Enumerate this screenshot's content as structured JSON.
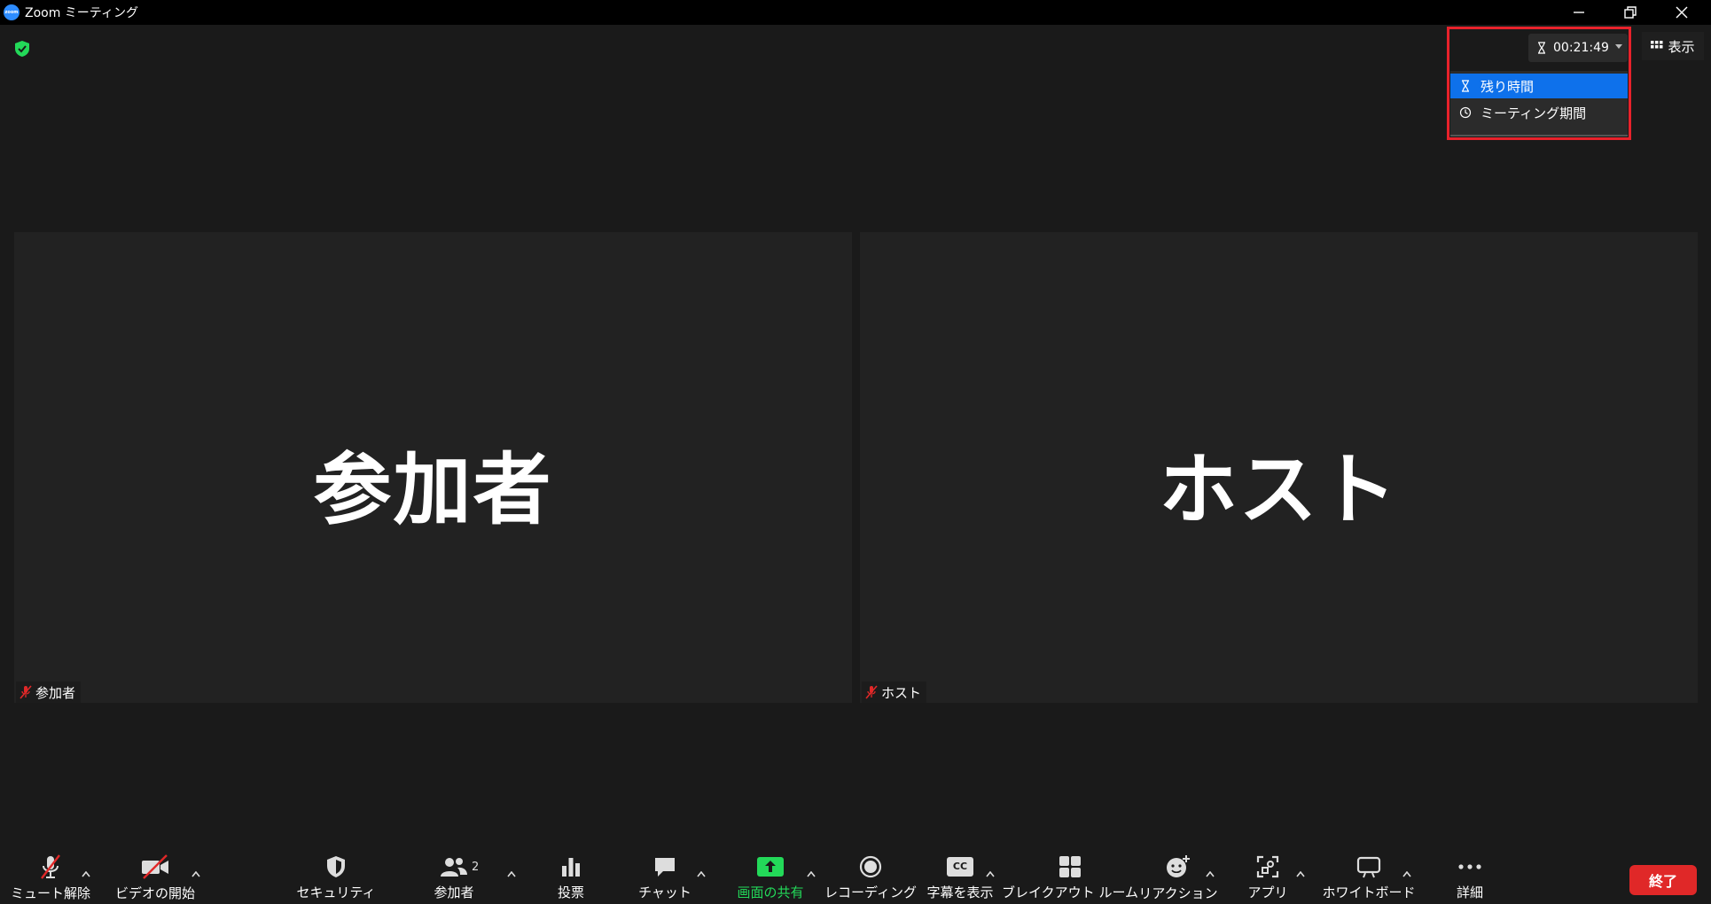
{
  "window": {
    "title": "Zoom ミーティング",
    "logo_text": "zoom"
  },
  "timer": {
    "value": "00:21:49",
    "menu": [
      {
        "label": "残り時間",
        "icon": "hourglass-icon",
        "selected": true
      },
      {
        "label": "ミーティング期間",
        "icon": "clock-icon",
        "selected": false
      }
    ],
    "highlight_color": "#e8222b"
  },
  "view_button": {
    "label": "表示"
  },
  "tiles": [
    {
      "name": "参加者",
      "label": "参加者",
      "muted": true
    },
    {
      "name": "ホスト",
      "label": "ホスト",
      "muted": true
    }
  ],
  "toolbar": {
    "unmute": "ミュート解除",
    "start_video": "ビデオの開始",
    "security": "セキュリティ",
    "participants": "参加者",
    "participants_count": "2",
    "polls": "投票",
    "chat": "チャット",
    "share_screen": "画面の共有",
    "recording": "レコーディング",
    "captions": "字幕を表示",
    "captions_icon_text": "CC",
    "breakout": "ブレイクアウト ルーム",
    "reactions": "リアクション",
    "apps": "アプリ",
    "whiteboard": "ホワイトボード",
    "more": "詳細",
    "end": "終了"
  },
  "colors": {
    "accent_blue": "#0e71eb",
    "share_green": "#23d959",
    "end_red": "#e02828",
    "shield_green": "#23d959"
  }
}
